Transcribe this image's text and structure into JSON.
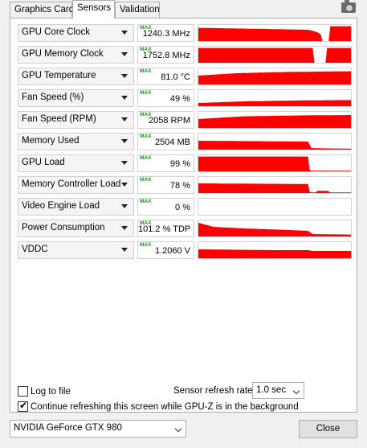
{
  "tabs": [
    {
      "label": "Graphics Card",
      "active": false
    },
    {
      "label": "Sensors",
      "active": true
    },
    {
      "label": "Validation",
      "active": false
    }
  ],
  "camera_icon": "camera-icon",
  "max_tag": "MAX",
  "graph_color": "#ff0000",
  "sensors": [
    {
      "name": "GPU Core Clock",
      "value": "1240.3 MHz",
      "profile": [
        [
          0,
          0.82
        ],
        [
          0.38,
          0.76
        ],
        [
          0.72,
          0.7
        ],
        [
          0.78,
          0.55
        ],
        [
          0.82,
          0.3
        ],
        [
          0.84,
          0.62
        ],
        [
          0.86,
          0.92
        ],
        [
          1,
          0.92
        ]
      ],
      "gap": [
        0.81,
        0.86
      ]
    },
    {
      "name": "GPU Memory Clock",
      "value": "1752.8 MHz",
      "profile": [
        [
          0,
          0.92
        ],
        [
          0.75,
          0.92
        ],
        [
          0.76,
          0.92
        ],
        [
          1,
          0.92
        ]
      ],
      "gap": [
        0.76,
        0.84
      ]
    },
    {
      "name": "GPU Temperature",
      "value": "81.0 °C",
      "profile": [
        [
          0,
          0.55
        ],
        [
          0.25,
          0.7
        ],
        [
          0.6,
          0.78
        ],
        [
          1,
          0.82
        ]
      ],
      "gap": null
    },
    {
      "name": "Fan Speed (%)",
      "value": "49 %",
      "profile": [
        [
          0,
          0.2
        ],
        [
          0.3,
          0.3
        ],
        [
          0.7,
          0.36
        ],
        [
          1,
          0.38
        ]
      ],
      "gap": null
    },
    {
      "name": "Fan Speed (RPM)",
      "value": "2058 RPM",
      "profile": [
        [
          0,
          0.55
        ],
        [
          0.3,
          0.72
        ],
        [
          0.7,
          0.78
        ],
        [
          1,
          0.8
        ]
      ],
      "gap": null
    },
    {
      "name": "Memory Used",
      "value": "2504 MB",
      "profile": [
        [
          0,
          0.55
        ],
        [
          0.72,
          0.5
        ],
        [
          0.74,
          0.1
        ],
        [
          0.8,
          0.08
        ],
        [
          1,
          0.06
        ]
      ],
      "gap": null
    },
    {
      "name": "GPU Load",
      "value": "99 %",
      "profile": [
        [
          0,
          0.92
        ],
        [
          0.72,
          0.92
        ],
        [
          0.73,
          0.04
        ],
        [
          1,
          0.04
        ]
      ],
      "gap": null
    },
    {
      "name": "Memory Controller Load",
      "value": "78 %",
      "profile": [
        [
          0,
          0.6
        ],
        [
          0.72,
          0.56
        ],
        [
          0.73,
          0.04
        ],
        [
          0.77,
          0.04
        ],
        [
          0.78,
          0.14
        ],
        [
          0.85,
          0.14
        ],
        [
          0.86,
          0.04
        ],
        [
          1,
          0.04
        ]
      ],
      "gap": null
    },
    {
      "name": "Video Engine Load",
      "value": "0 %",
      "profile": [
        [
          0,
          0.0
        ],
        [
          1,
          0.0
        ]
      ],
      "gap": null
    },
    {
      "name": "Power Consumption",
      "value": "101.2 % TDP",
      "profile": [
        [
          0,
          0.85
        ],
        [
          0.1,
          0.6
        ],
        [
          0.3,
          0.5
        ],
        [
          0.6,
          0.4
        ],
        [
          0.72,
          0.35
        ],
        [
          0.75,
          0.15
        ],
        [
          1,
          0.12
        ]
      ],
      "gap": null
    },
    {
      "name": "VDDC",
      "value": "1.2060 V",
      "profile": [
        [
          0,
          0.55
        ],
        [
          0.5,
          0.5
        ],
        [
          0.72,
          0.5
        ],
        [
          0.75,
          0.45
        ],
        [
          1,
          0.45
        ]
      ],
      "gap": null
    }
  ],
  "options": {
    "log_to_file": {
      "label": "Log to file",
      "checked": false
    },
    "continue_refresh": {
      "label": "Continue refreshing this screen while GPU-Z is in the background",
      "checked": true
    }
  },
  "refresh": {
    "label": "Sensor refresh rate:",
    "value": "1.0 sec"
  },
  "gpu_select": {
    "value": "NVIDIA GeForce GTX 980"
  },
  "close_button": {
    "label": "Close"
  }
}
